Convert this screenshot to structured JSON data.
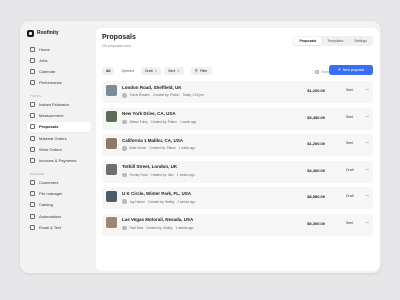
{
  "app": {
    "name": "Roofinity"
  },
  "sidebar": {
    "primary": [
      {
        "label": "Home",
        "icon": "home-icon"
      },
      {
        "label": "Jobs",
        "icon": "briefcase-icon"
      },
      {
        "label": "Calendar",
        "icon": "calendar-icon"
      },
      {
        "label": "Performance",
        "icon": "chart-icon"
      }
    ],
    "tools_title": "TOOLS",
    "tools": [
      {
        "label": "Instant Estimator",
        "icon": "calculator-icon"
      },
      {
        "label": "Measurement",
        "icon": "ruler-icon"
      },
      {
        "label": "Proposals",
        "icon": "document-icon",
        "active": true
      },
      {
        "label": "Material Orders",
        "icon": "box-icon"
      },
      {
        "label": "Work Orders",
        "icon": "clipboard-icon"
      },
      {
        "label": "Invoices & Payments",
        "icon": "invoice-icon"
      }
    ],
    "manage_title": "MANAGE",
    "manage": [
      {
        "label": "Customers",
        "icon": "users-icon"
      },
      {
        "label": "File manager",
        "icon": "folder-icon"
      },
      {
        "label": "Catalog",
        "icon": "catalog-icon"
      },
      {
        "label": "Automations",
        "icon": "automation-icon"
      },
      {
        "label": "Email & Text",
        "icon": "mail-icon"
      }
    ]
  },
  "header": {
    "title": "Proposals",
    "subtitle": "2/5 proposals sent",
    "tabs": [
      {
        "label": "Proposals",
        "active": true
      },
      {
        "label": "Templates"
      },
      {
        "label": "Settings"
      }
    ]
  },
  "filters": {
    "chips": [
      "All",
      "Opened"
    ],
    "active_chips": [
      "Draft",
      "Sent"
    ],
    "filter_label": "Filter"
  },
  "search": {
    "placeholder": "Search..."
  },
  "new_button": {
    "label": "New proposal",
    "color": "#3a6ff5"
  },
  "proposals": [
    {
      "address": "London Road, Sheffield, UK",
      "owner": "Travis Rosario",
      "created_by": "Created by: Platon",
      "time": "Today, 1:00 pm",
      "price": "$1,200.00",
      "status": "Sent",
      "thumb_color": "#7d8a96"
    },
    {
      "address": "New York Drive, CA, USA",
      "owner": "Allison Foley",
      "created_by": "Created by: Platon",
      "time": "1 week ago",
      "price": "$3,450.00",
      "status": "Sent",
      "thumb_color": "#5f6b5a"
    },
    {
      "address": "California 1 Malibu, CA, USA",
      "owner": "Briar House",
      "created_by": "Created by: Platon",
      "time": "1 week ago",
      "price": "$1,200.00",
      "status": "Sent",
      "thumb_color": "#8a7b6c"
    },
    {
      "address": "Tothill Street, London, UK",
      "owner": "Finnley Todd",
      "created_by": "Created by: Alex",
      "time": "1 weeks ago",
      "price": "$4,400.00",
      "status": "Draft",
      "thumb_color": "#6e6e72"
    },
    {
      "address": "U K Circle, Winter Park, FL, USA",
      "owner": "Jay Horton",
      "created_by": "Created by: Brattly",
      "time": "2 weeks ago",
      "price": "$8,580.00",
      "status": "Draft",
      "thumb_color": "#4d5a6b"
    },
    {
      "address": "Las Vegas Motorail, Nevada, USA",
      "owner": "Paul Diaz",
      "created_by": "Created by: Brattly",
      "time": "1 weeks ago",
      "price": "$5,300.00",
      "status": "Sent",
      "thumb_color": "#9a8870"
    }
  ]
}
